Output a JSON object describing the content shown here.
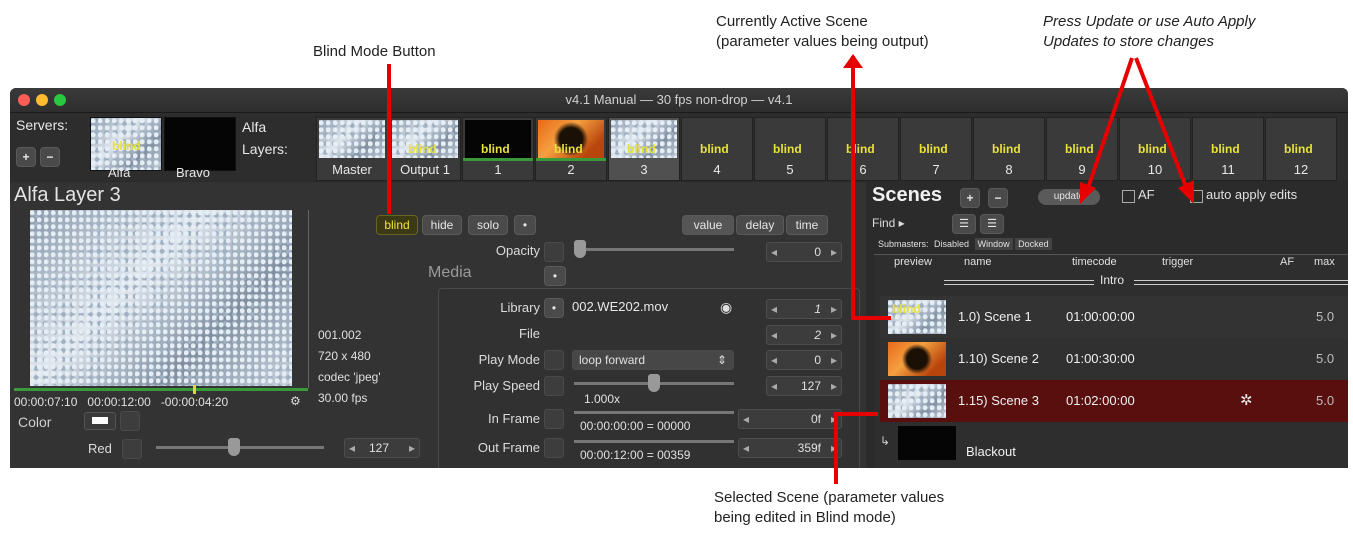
{
  "annotations": {
    "blind_mode": "Blind Mode Button",
    "active_scene_1": "Currently Active Scene",
    "active_scene_2": "(parameter values being output)",
    "update_1": "Press Update or use Auto Apply",
    "update_2": "Updates to store changes",
    "selected_1": "Selected Scene (parameter values",
    "selected_2": "being edited in Blind mode)"
  },
  "window": {
    "title": "v4.1 Manual  —  30 fps non-drop  —  v4.1"
  },
  "servers": {
    "label": "Servers:",
    "items": [
      "Alfa",
      "Bravo"
    ],
    "current": "Alfa",
    "layers_label": "Layers:"
  },
  "layers": [
    {
      "name": "Master",
      "tag": ""
    },
    {
      "name": "Output 1",
      "tag": "blind"
    },
    {
      "name": "1",
      "tag": "blind"
    },
    {
      "name": "2",
      "tag": "blind"
    },
    {
      "name": "3",
      "tag": "blind"
    },
    {
      "name": "4",
      "tag": "blind"
    },
    {
      "name": "5",
      "tag": "blind"
    },
    {
      "name": "6",
      "tag": "blind"
    },
    {
      "name": "7",
      "tag": "blind"
    },
    {
      "name": "8",
      "tag": "blind"
    },
    {
      "name": "9",
      "tag": "blind"
    },
    {
      "name": "10",
      "tag": "blind"
    },
    {
      "name": "11",
      "tag": "blind"
    },
    {
      "name": "12",
      "tag": "blind"
    }
  ],
  "left_panel": {
    "title_server": "Alfa",
    "title_layer": "Layer 3",
    "media_info": [
      "001.002",
      "720 x 480",
      "codec 'jpeg'",
      "30.00 fps"
    ],
    "timecodes": [
      "00:00:07:10",
      "00:00:12:00",
      "-00:00:04:20"
    ],
    "color_label": "Color",
    "red_label": "Red",
    "red_value": "127"
  },
  "mid_panel": {
    "buttons": {
      "blind": "blind",
      "hide": "hide",
      "solo": "solo"
    },
    "tabs": [
      "value",
      "delay",
      "time"
    ],
    "opacity_label": "Opacity",
    "opacity_value": "0",
    "media_label": "Media",
    "library_label": "Library",
    "library_file": "002.WE202.mov",
    "library_value": "1",
    "file_label": "File",
    "file_value": "2",
    "play_mode_label": "Play Mode",
    "play_mode_value": "loop forward",
    "play_mode_num": "0",
    "play_speed_label": "Play Speed",
    "play_speed_value": "1.000x",
    "play_speed_num": "127",
    "in_frame_label": "In Frame",
    "in_frame_tc": "00:00:00:00 = 00000",
    "in_frame_num": "0f",
    "out_frame_label": "Out Frame",
    "out_frame_tc": "00:00:12:00 = 00359",
    "out_frame_num": "359f"
  },
  "scenes": {
    "title": "Scenes",
    "update_label": "update",
    "af_label": "AF",
    "auto_apply_label": "auto apply edits",
    "find_label": "Find ▸",
    "submasters_label": "Submasters:",
    "submasters_opts": [
      "Disabled",
      "Window",
      "Docked"
    ],
    "columns": [
      "preview",
      "name",
      "timecode",
      "trigger",
      "AF",
      "max"
    ],
    "group": "Intro",
    "rows": [
      {
        "name": "1.0) Scene 1",
        "timecode": "01:00:00:00",
        "max": "5.0",
        "tag": "blind"
      },
      {
        "name": "1.10) Scene 2",
        "timecode": "01:00:30:00",
        "max": "5.0",
        "tag": ""
      },
      {
        "name": "1.15) Scene 3",
        "timecode": "01:02:00:00",
        "max": "5.0",
        "tag": ""
      }
    ],
    "blackout": "Blackout"
  },
  "colors": {
    "blind_yellow": "#f0e43a",
    "selected_row": "#5a0f0f",
    "callout_red": "#e60000"
  }
}
